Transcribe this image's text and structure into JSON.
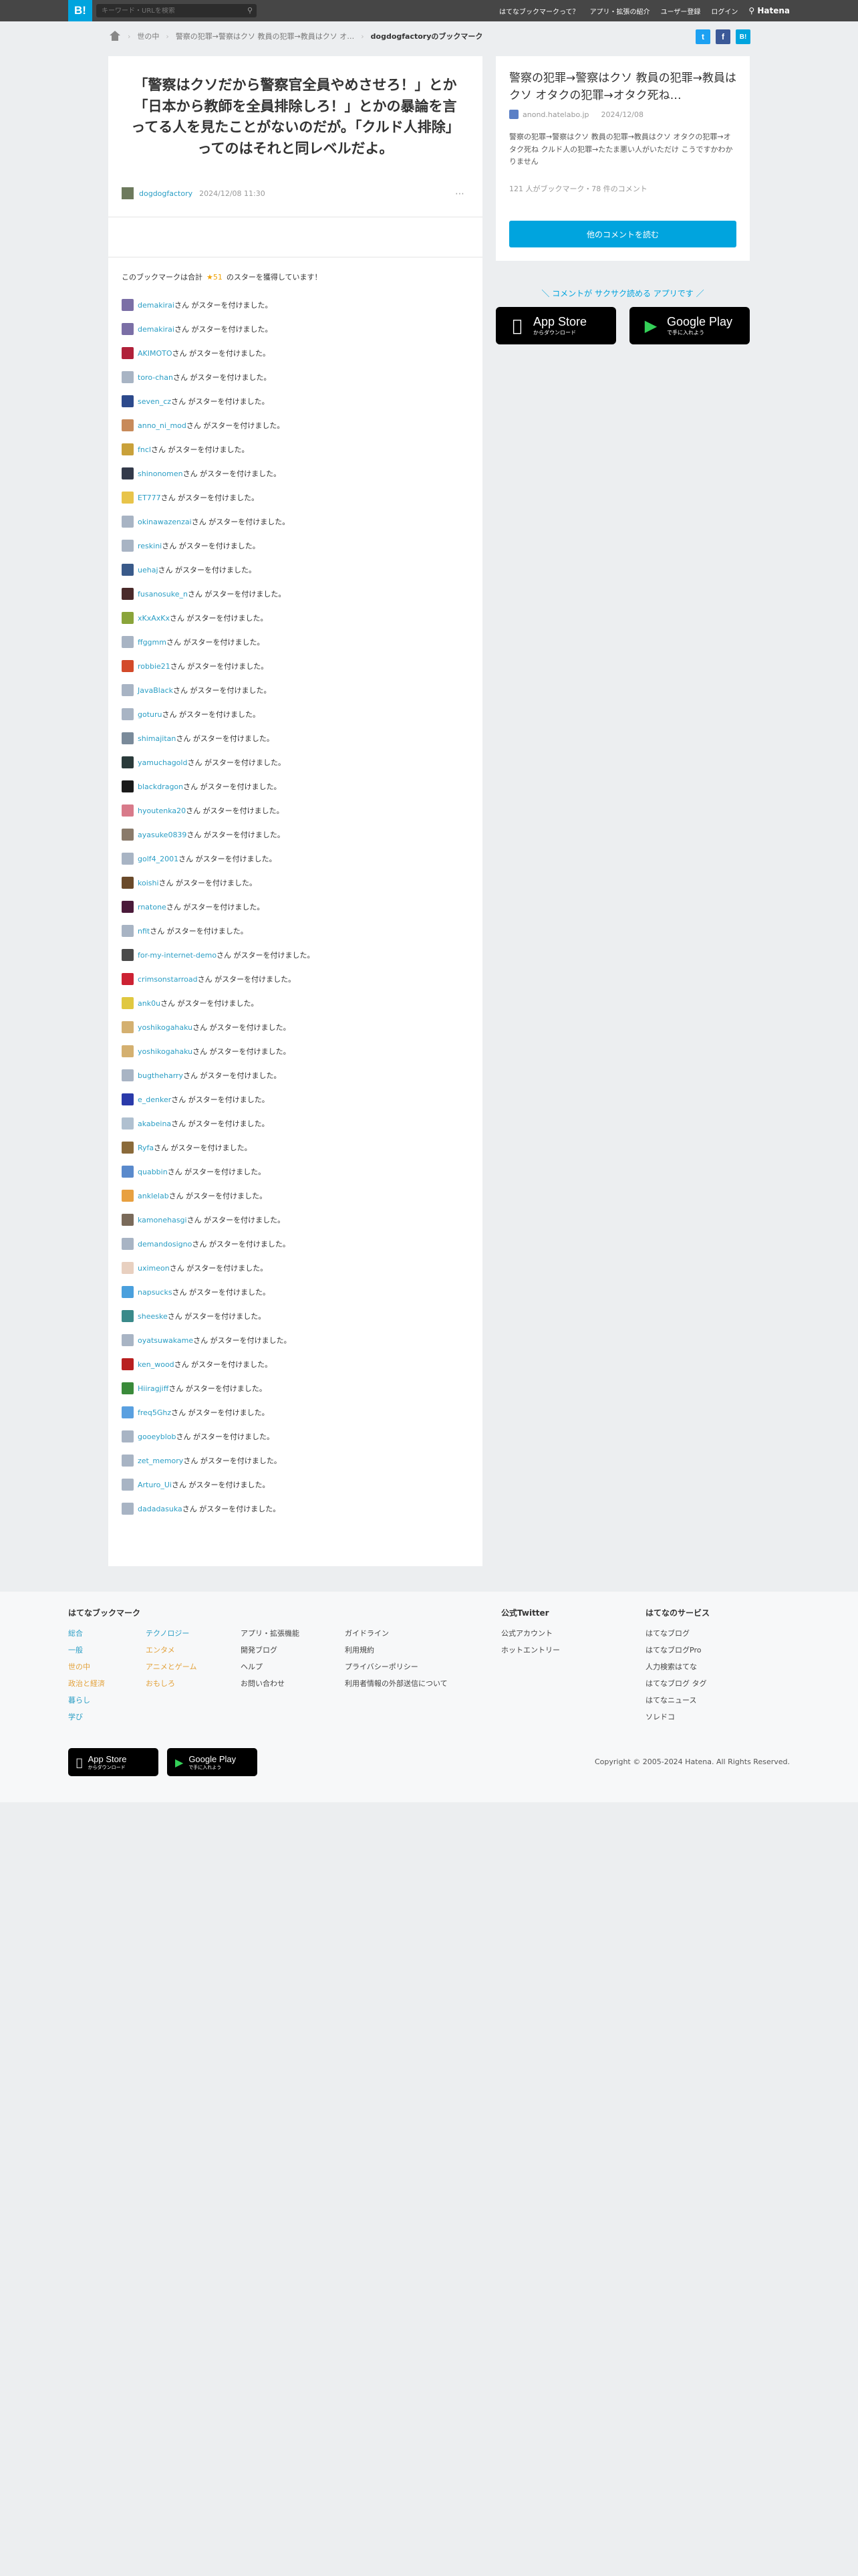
{
  "header": {
    "logo": "B!",
    "search_placeholder": "キーワード・URLを検索",
    "nav": [
      "はてなブックマークって？",
      "アプリ・拡張の紹介",
      "ユーザー登録",
      "ログイン"
    ],
    "hatena_label": "Hatena"
  },
  "breadcrumb": {
    "items": [
      "世の中",
      "警察の犯罪→警察はクソ 教員の犯罪→教員はクソ オ…"
    ],
    "current": "dogdogfactoryのブックマーク"
  },
  "share": {
    "twitter": "t",
    "facebook": "f",
    "hatebu": "B!"
  },
  "bookmark": {
    "comment": "「警察はクソだから警察官全員やめさせろ！」とか「日本から教師を全員排除しろ！」とかの暴論を言ってる人を見たことがないのだが。「クルド人排除」ってのはそれと同レベルだよ。",
    "user": "dogdogfactory",
    "date": "2024/12/08 11:30",
    "more": "⋯"
  },
  "stars": {
    "prefix": "このブックマークは合計",
    "count": "★51",
    "suffix": "のスターを獲得しています！",
    "suffix_row": "さん がスターを付けました。",
    "users": [
      "demakirai",
      "demakirai",
      "AKIMOTO",
      "toro-chan",
      "seven_cz",
      "anno_ni_mod",
      "fncl",
      "shinonomen",
      "ET777",
      "okinawazenzai",
      "reskini",
      "uehaj",
      "fusanosuke_n",
      "xKxAxKx",
      "ffggmm",
      "robbie21",
      "JavaBlack",
      "goturu",
      "shimajitan",
      "yamuchagold",
      "blackdragon",
      "hyoutenka20",
      "ayasuke0839",
      "golf4_2001",
      "koishi",
      "rnatone",
      "nfit",
      "for-my-internet-demo",
      "crimsonstarroad",
      "ank0u",
      "yoshikogahaku",
      "yoshikogahaku",
      "bugtheharry",
      "e_denker",
      "akabeina",
      "Ryfa",
      "quabbin",
      "anklelab",
      "kamonehasgi",
      "demandosigno",
      "uximeon",
      "napsucks",
      "sheeske",
      "oyatsuwakame",
      "ken_wood",
      "Hiiragjiff",
      "freq5Ghz",
      "gooeyblob",
      "zet_memory",
      "Arturo_Ui",
      "dadadasuka"
    ],
    "icon_colors": [
      "#7b6fa6",
      "#7b6fa6",
      "#b0213a",
      "#a8b4c4",
      "#2d4a8c",
      "#c88a5a",
      "#c9a13a",
      "#333a4a",
      "#e8c44a",
      "#a8b4c4",
      "#a8b4c4",
      "#3a5a8a",
      "#4a2a2a",
      "#8aa43a",
      "#a8b4c4",
      "#d34a2a",
      "#a8b4c4",
      "#a8b4c4",
      "#7a8a9a",
      "#2a3a3a",
      "#1a1a1a",
      "#d87a8a",
      "#8a7a6a",
      "#a8b4c4",
      "#6a4a2a",
      "#4a1a3a",
      "#a8b4c4",
      "#4a4a4a",
      "#cc2233",
      "#e0c840",
      "#d4b070",
      "#d4b070",
      "#a8b4c4",
      "#2a3aaa",
      "#b0c0d0",
      "#8a6a3a",
      "#5a8acc",
      "#e8a040",
      "#7a6a5a",
      "#a8b4c4",
      "#e8d0c0",
      "#4aa0dd",
      "#3a8a8a",
      "#a8b4c4",
      "#b82020",
      "#3a8a3a",
      "#5aa0e0",
      "#a8b4c4",
      "#a8b4c4",
      "#a8b4c4",
      "#a8b4c4"
    ]
  },
  "entry": {
    "title": "警察の犯罪→警察はクソ 教員の犯罪→教員はクソ オタクの犯罪→オタク死ね…",
    "site": "anond.hatelabo.jp",
    "date": "2024/12/08",
    "desc": "警察の犯罪→警察はクソ 教員の犯罪→教員はクソ オタクの犯罪→オタク死ね クルド人の犯罪→たたま悪い人がいただけ こうですかわかりません",
    "counts": "121 人がブックマーク・78 件のコメント",
    "button": "他のコメントを読む"
  },
  "promo": {
    "text": "＼ コメントが サクサク読める アプリです ／",
    "appstore_small": "からダウンロード",
    "appstore_big": "App Store",
    "gplay_small": "で手に入れよう",
    "gplay_big": "Google Play"
  },
  "footer": {
    "col1_head": "はてなブックマーク",
    "col1a": [
      "総合",
      "一般",
      "世の中",
      "政治と経済",
      "暮らし",
      "学び"
    ],
    "col1b": [
      "テクノロジー",
      "エンタメ",
      "アニメとゲーム",
      "おもしろ"
    ],
    "col2": [
      "アプリ・拡張機能",
      "開発ブログ",
      "ヘルプ",
      "お問い合わせ"
    ],
    "col3": [
      "ガイドライン",
      "利用規約",
      "プライバシーポリシー",
      "利用者情報の外部送信について"
    ],
    "col4_head": "公式Twitter",
    "col4": [
      "公式アカウント",
      "ホットエントリー"
    ],
    "col5_head": "はてなのサービス",
    "col5": [
      "はてなブログ",
      "はてなブログPro",
      "人力検索はてな",
      "はてなブログ タグ",
      "はてなニュース",
      "ソレドコ"
    ],
    "copyright": "Copyright © 2005-2024 Hatena. All Rights Reserved."
  }
}
